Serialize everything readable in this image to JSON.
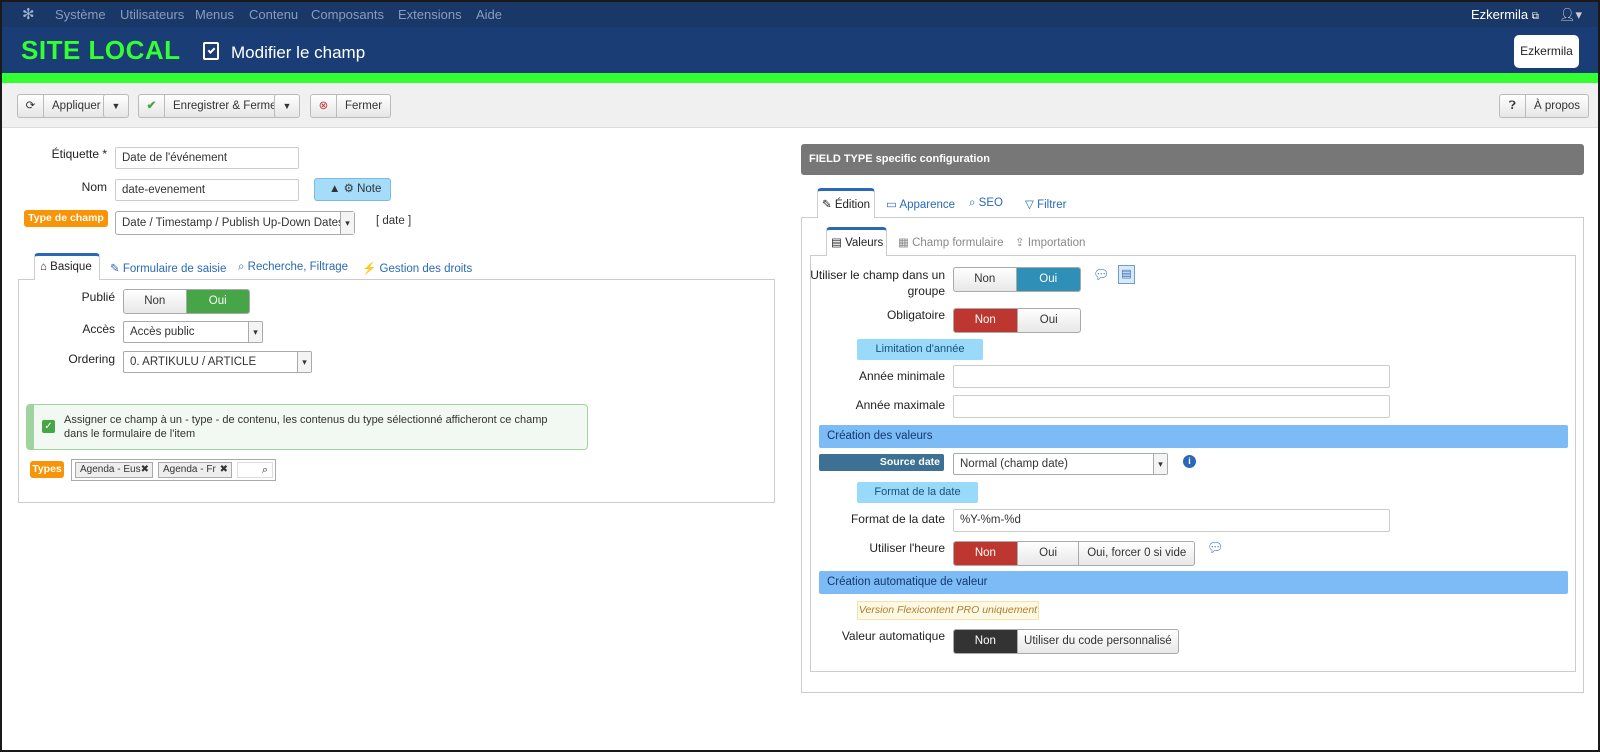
{
  "topnav": {
    "menu": [
      "Système",
      "Utilisateurs",
      "Menus",
      "Contenu",
      "Composants",
      "Extensions",
      "Aide"
    ],
    "site_link": "Ezkermila"
  },
  "header": {
    "site_name": "SITE LOCAL",
    "page_title": "Modifier le champ",
    "user_button": "Ezkermila"
  },
  "toolbar": {
    "apply": "Appliquer",
    "save_close": "Enregistrer & Fermer",
    "close": "Fermer",
    "about": "À propos"
  },
  "form": {
    "label_label": "Étiquette *",
    "label_value": "Date de l'événement",
    "name_label": "Nom",
    "name_value": "date-evenement",
    "note_button": "Note",
    "type_badge": "Type de champ",
    "type_value": "Date / Timestamp / Publish Up-Down Dates",
    "type_code": "[ date ]"
  },
  "left_tabs": [
    "Basique",
    "Formulaire de saisie",
    "Recherche, Filtrage",
    "Gestion des droits"
  ],
  "basic": {
    "published_label": "Publié",
    "toggle_no": "Non",
    "toggle_yes": "Oui",
    "access_label": "Accès",
    "access_value": "Accès public",
    "ordering_label": "Ordering",
    "ordering_value": "0. ARTIKULU / ARTICLE",
    "assign_notice": "Assigner ce champ à un - type - de contenu, les contenus du type sélectionné afficheront ce champ dans le formulaire de l'item",
    "types_badge": "Types",
    "types_chips": [
      "Agenda - Eus",
      "Agenda - Fr"
    ]
  },
  "right": {
    "panel_title": "FIELD TYPE specific configuration",
    "tabs": [
      "Édition",
      "Apparence",
      "SEO",
      "Filtrer"
    ],
    "subtabs": [
      "Valeurs",
      "Champ formulaire",
      "Importation"
    ],
    "use_group_label_1": "Utiliser le champ dans un",
    "use_group_label_2": "groupe",
    "mandatory_label": "Obligatoire",
    "no": "Non",
    "yes": "Oui",
    "year_limit_head": "Limitation d'année",
    "min_year_label": "Année minimale",
    "max_year_label": "Année maximale",
    "values_creation_bar": "Création des valeurs",
    "source_date_badge": "Source date",
    "source_date_value": "Normal (champ date)",
    "date_format_head": "Format de la date",
    "date_format_label": "Format de la date",
    "date_format_value": "%Y-%m-%d",
    "use_time_label": "Utiliser l'heure",
    "use_time_force": "Oui, forcer 0 si vide",
    "auto_value_bar": "Création automatique de valeur",
    "pro_notice": "Version Flexicontent PRO uniquement",
    "auto_value_label": "Valeur automatique",
    "auto_custom": "Utiliser du code personnalisé"
  },
  "colors": {
    "nav": "#1a3867",
    "header": "#1b3d75",
    "accent_green": "#33ff33",
    "orange": "#f89406",
    "red": "#bd362f",
    "blue_toggle": "#2f8fb6"
  }
}
